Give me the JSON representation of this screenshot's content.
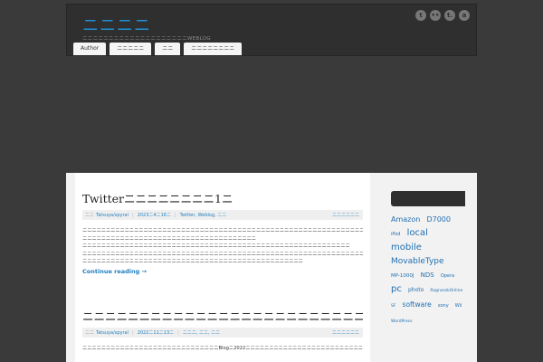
{
  "site": {
    "title": "ニニニニ",
    "description": "ニニニニニニニニニニニニニニニニニニニニWEBLOG"
  },
  "social_icons": [
    {
      "name": "twitter-icon",
      "glyph": "t"
    },
    {
      "name": "flickr-icon",
      "glyph": "••"
    },
    {
      "name": "tumblr-icon",
      "glyph": "t."
    },
    {
      "name": "amazon-icon",
      "glyph": "a"
    }
  ],
  "nav": [
    "Author",
    "ニニニニニ",
    "ニニ",
    "ニニニニニニニニ"
  ],
  "posts": [
    {
      "title": "Twitterニニニニニニニニ1ニ",
      "author": "Tatsuya/spyral",
      "date": "2023ニ4ニ16ニ",
      "categories": "Twitter, Weblog, ニニ",
      "comments": "ニニニニニニ",
      "excerpt": [
        "ニニニニニニニニニニニニニニニニニニニニニニニニニニニニニニニニニニニニニニニニニニニニニニニニニニニニニニニニニニニニニニニニニニニニニニニニ",
        "ニニニニニニニニニニニニニニニニニニニニニニニニニニニニニニニニニニニニニ",
        "ニニニニニニニニニニニニニニニニニニニニニニニニニニニニニニニニニニニニニニニニニニニニニニニニニニニニニニニニニ",
        "ニニニニニニニニニニニニニニニニニニニニニニニニニニニニニニニニニニニニニニニニニニニニニニニニニニニニニニニニニニニニニニニニ",
        "ニニニニニニニニニニニニニニニニニニニニニニニニニニニニニニニニニニニニニニニニニニニニニニニ"
      ],
      "more": "Continue reading →"
    },
    {
      "title": "ニニニニニニニニニニニニニニニニニニニニニニニニニニ",
      "author": "Tatsuya/spyral",
      "date": "2022ニ11ニ13ニ",
      "categories": "ニニニ, ニニ, ニニ",
      "comments": "ニニニニニニ",
      "excerpt": [
        "ニニニニニニニニニニニニニニニニニニニニニニニニニニニニニBlogニ2022ニニニニニニニニニニニニニニニニニニニニニニニニニニ"
      ]
    }
  ],
  "tag_cloud": [
    {
      "tag": "Amazon",
      "size": 8
    },
    {
      "tag": "D7000",
      "size": 8
    },
    {
      "tag": "iPod",
      "size": 5
    },
    {
      "tag": "local",
      "size": 10
    },
    {
      "tag": "mobile",
      "size": 10
    },
    {
      "tag": "MovableType",
      "size": 9
    },
    {
      "tag": "MP-1000J",
      "size": 5.5
    },
    {
      "tag": "NDS",
      "size": 7
    },
    {
      "tag": "Opera",
      "size": 5
    },
    {
      "tag": "pc",
      "size": 10
    },
    {
      "tag": "photo",
      "size": 6
    },
    {
      "tag": "RagnarokOnline",
      "size": 4.5
    },
    {
      "tag": "SF",
      "size": 4.5
    },
    {
      "tag": "software",
      "size": 7.5
    },
    {
      "tag": "sony",
      "size": 5
    },
    {
      "tag": "Wii",
      "size": 5
    },
    {
      "tag": "WordPress",
      "size": 4.5
    }
  ]
}
